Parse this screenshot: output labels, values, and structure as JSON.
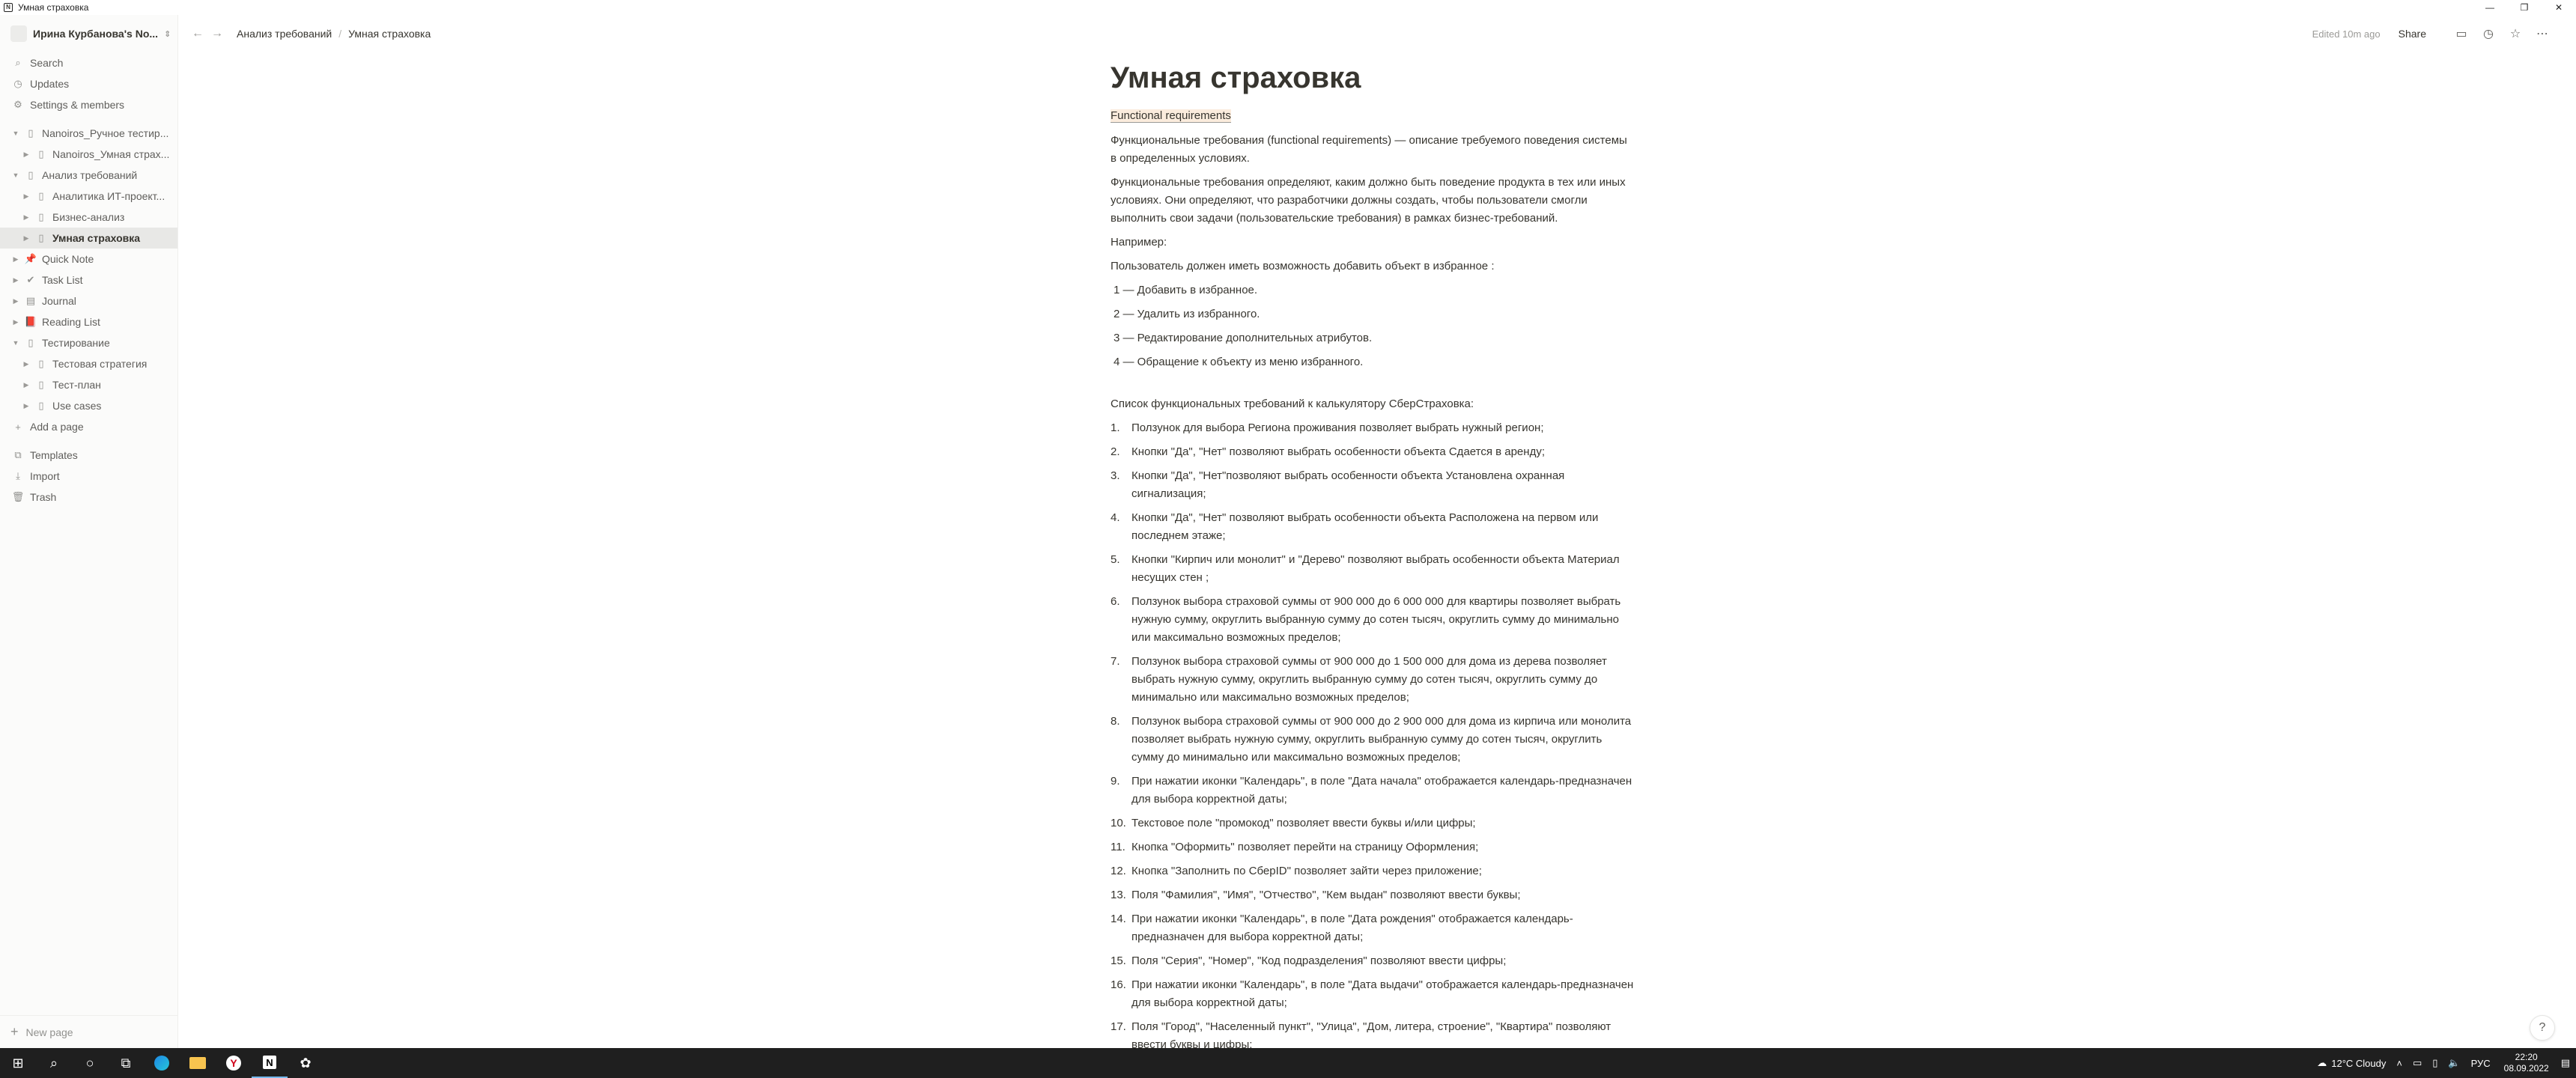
{
  "window": {
    "title": "Умная страховка",
    "controls": [
      "—",
      "❐",
      "✕"
    ]
  },
  "sidebar": {
    "workspace": "Ирина Курбанова's No...",
    "actions": [
      {
        "icon": "search-icon",
        "glyph": "⌕",
        "label": "Search"
      },
      {
        "icon": "updates-icon",
        "glyph": "◷",
        "label": "Updates"
      },
      {
        "icon": "gear-icon",
        "glyph": "⚙",
        "label": "Settings & members"
      }
    ],
    "tree": [
      {
        "label": "Nanoiros_Ручное тестир...",
        "level": 0,
        "expanded": true
      },
      {
        "label": "Nanoiros_Умная страх...",
        "level": 1,
        "expanded": false
      },
      {
        "label": "Анализ требований",
        "level": 0,
        "expanded": true
      },
      {
        "label": "Аналитика ИТ-проект...",
        "level": 1,
        "expanded": false
      },
      {
        "label": "Бизнес-анализ",
        "level": 1,
        "expanded": false
      },
      {
        "label": "Умная страховка",
        "level": 1,
        "expanded": false,
        "active": true
      },
      {
        "label": "Quick Note",
        "level": 0,
        "expanded": false,
        "icon": "📌"
      },
      {
        "label": "Task List",
        "level": 0,
        "expanded": false,
        "icon": "✔"
      },
      {
        "label": "Journal",
        "level": 0,
        "expanded": false,
        "icon": "▤"
      },
      {
        "label": "Reading List",
        "level": 0,
        "expanded": false,
        "icon": "📕"
      },
      {
        "label": "Тестирование",
        "level": 0,
        "expanded": true
      },
      {
        "label": "Тестовая стратегия",
        "level": 1,
        "expanded": false
      },
      {
        "label": "Тест-план",
        "level": 1,
        "expanded": false
      },
      {
        "label": "Use cases",
        "level": 1,
        "expanded": false
      }
    ],
    "add_page": "Add a page",
    "bottom_actions": [
      {
        "icon": "templates-icon",
        "glyph": "⧉",
        "label": "Templates"
      },
      {
        "icon": "import-icon",
        "glyph": "⤓",
        "label": "Import"
      },
      {
        "icon": "trash-icon",
        "glyph": "🗑",
        "label": "Trash"
      }
    ],
    "new_page": "New page"
  },
  "topbar": {
    "breadcrumb": [
      "Анализ требований",
      "Умная страховка"
    ],
    "edited": "Edited 10m ago",
    "share": "Share"
  },
  "doc": {
    "title": "Умная страховка",
    "link": "Functional requirements",
    "paragraphs_intro": [
      "Функциональные требования (functional requirements) — описание требуемого поведения системы в определенных условиях.",
      "Функциональные требования определяют, каким должно быть поведение продукта в тех или иных условиях. Они определяют, что разработчики должны создать, чтобы пользователи смогли выполнить свои задачи (пользовательские требования) в рамках бизнес-требований.",
      "Например:",
      "Пользователь должен иметь возможность добавить объект в избранное :"
    ],
    "example_items": [
      "1 — Добавить в избранное.",
      "2 — Удалить из избранного.",
      "3 — Редактирование дополнительных атрибутов.",
      "4 — Обращение к объекту из меню избранного."
    ],
    "list_heading": "Список функциональных требований к калькулятору СберСтраховка:",
    "requirements": [
      {
        "n": "1.",
        "t": "Ползунок для выбора Региона проживания позволяет выбрать нужный регион;"
      },
      {
        "n": "2.",
        "t": "Кнопки \"Да\", \"Нет\" позволяют выбрать  особенности объекта Сдается в аренду;"
      },
      {
        "n": "3.",
        "t": "Кнопки \"Да\", \"Нет\"позволяют выбрать  особенности объекта Установлена охранная сигнализация;"
      },
      {
        "n": "4.",
        "t": "Кнопки \"Да\", \"Нет\" позволяют выбрать  особенности объекта Расположена на первом или последнем этаже;"
      },
      {
        "n": "5.",
        "t": "Кнопки \"Кирпич или монолит\" и \"Дерево\" позволяют выбрать особенности объекта Материал несущих стен ;"
      },
      {
        "n": "6.",
        "t": "Ползунок выбора страховой суммы от 900 000 до 6 000 000 для квартиры позволяет выбрать нужную сумму, округлить выбранную сумму до сотен тысяч, округлить сумму до минимально или максимально возможных пределов;"
      },
      {
        "n": "7.",
        "t": "Ползунок выбора страховой суммы от 900 000 до 1 500 000 для дома из дерева позволяет выбрать нужную сумму, округлить выбранную сумму до сотен тысяч, округлить сумму до минимально или максимально возможных пределов;"
      },
      {
        "n": "8.",
        "t": "Ползунок выбора страховой суммы от 900 000 до 2 900 000 для дома из кирпича или монолита позволяет выбрать нужную сумму, округлить выбранную сумму до сотен тысяч, округлить сумму до минимально или максимально возможных пределов;"
      },
      {
        "n": "9.",
        "t": "При нажатии иконки \"Календарь\", в поле \"Дата начала\" отображается календарь-предназначен для выбора корректной даты;"
      },
      {
        "n": "10.",
        "t": "Текстовое поле \"промокод\" позволяет ввести буквы и/или цифры;"
      },
      {
        "n": "11.",
        "t": "Кнопка \"Оформить\" позволяет перейти на страницу Оформления;"
      },
      {
        "n": "12.",
        "t": "Кнопка \"Заполнить по СберID\"  позволяет зайти через приложение;"
      },
      {
        "n": "13.",
        "t": "Поля \"Фамилия\", \"Имя\", \"Отчество\", \"Кем выдан\" позволяют ввести буквы;"
      },
      {
        "n": "14.",
        "t": "При нажатии иконки \"Календарь\", в поле \"Дата рождения\" отображается календарь-предназначен для выбора корректной даты;"
      },
      {
        "n": "15.",
        "t": "Поля \"Серия\", \"Номер\", \"Код подразделения\" позволяют ввести цифры;"
      },
      {
        "n": "16.",
        "t": "При нажатии иконки \"Календарь\", в поле \"Дата выдачи\" отображается календарь-предназначен для выбора корректной даты;"
      },
      {
        "n": "17.",
        "t": "Поля \"Город\", \"Населенный пункт\", \"Улица\", \"Дом, литера, строение\", \"Квартира\" позволяют ввести буквы и цифры;"
      }
    ]
  },
  "taskbar": {
    "weather": "12°C  Cloudy",
    "lang": "РУС",
    "time": "22:20",
    "date": "08.09.2022"
  }
}
